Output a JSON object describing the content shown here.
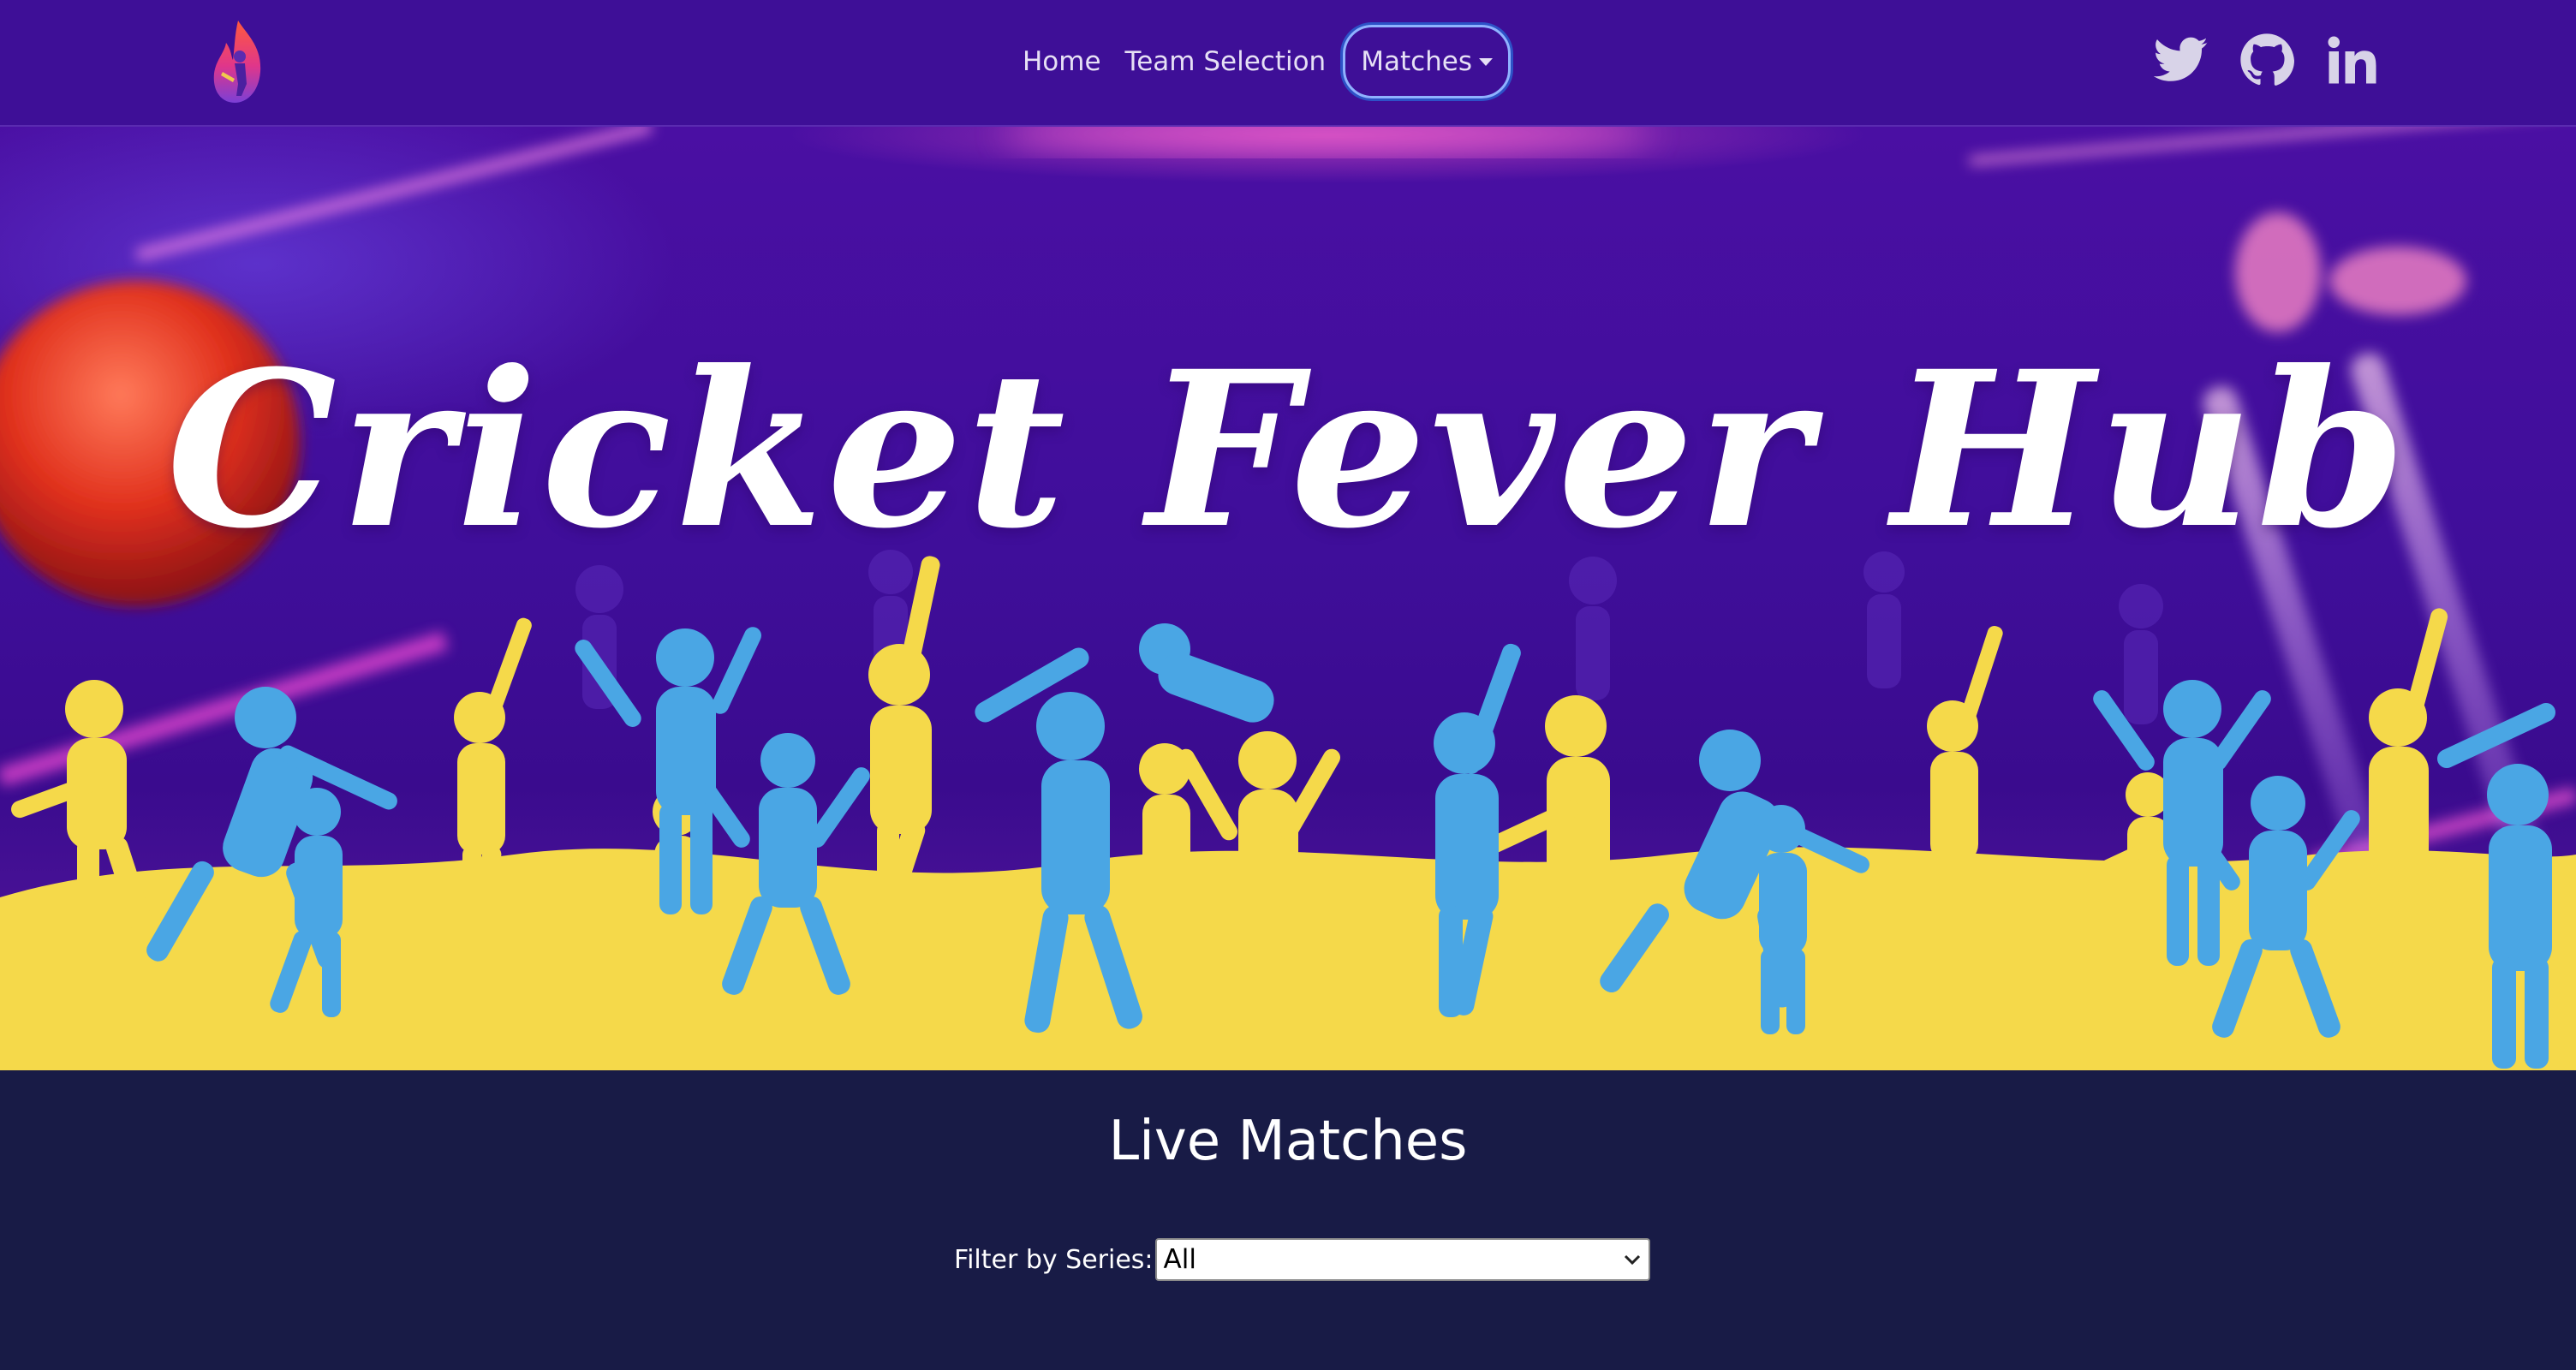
{
  "colors": {
    "navbar": "#3e0f97",
    "page_bg": "#181b46",
    "hero_yellow": "#f5d94a",
    "hero_blue": "#4aa6e4",
    "dropdown_outline": "#8fb2ff"
  },
  "navbar": {
    "logo_icon": "cricket-flame-logo",
    "links": [
      "Home",
      "Team Selection"
    ],
    "dropdown_label": "Matches",
    "socials": [
      "twitter-icon",
      "github-icon",
      "linkedin-icon"
    ]
  },
  "hero": {
    "title": "Cricket Fever Hub"
  },
  "live": {
    "title": "Live Matches",
    "filter_label": "Filter by Series:",
    "filter_selected": "All"
  }
}
